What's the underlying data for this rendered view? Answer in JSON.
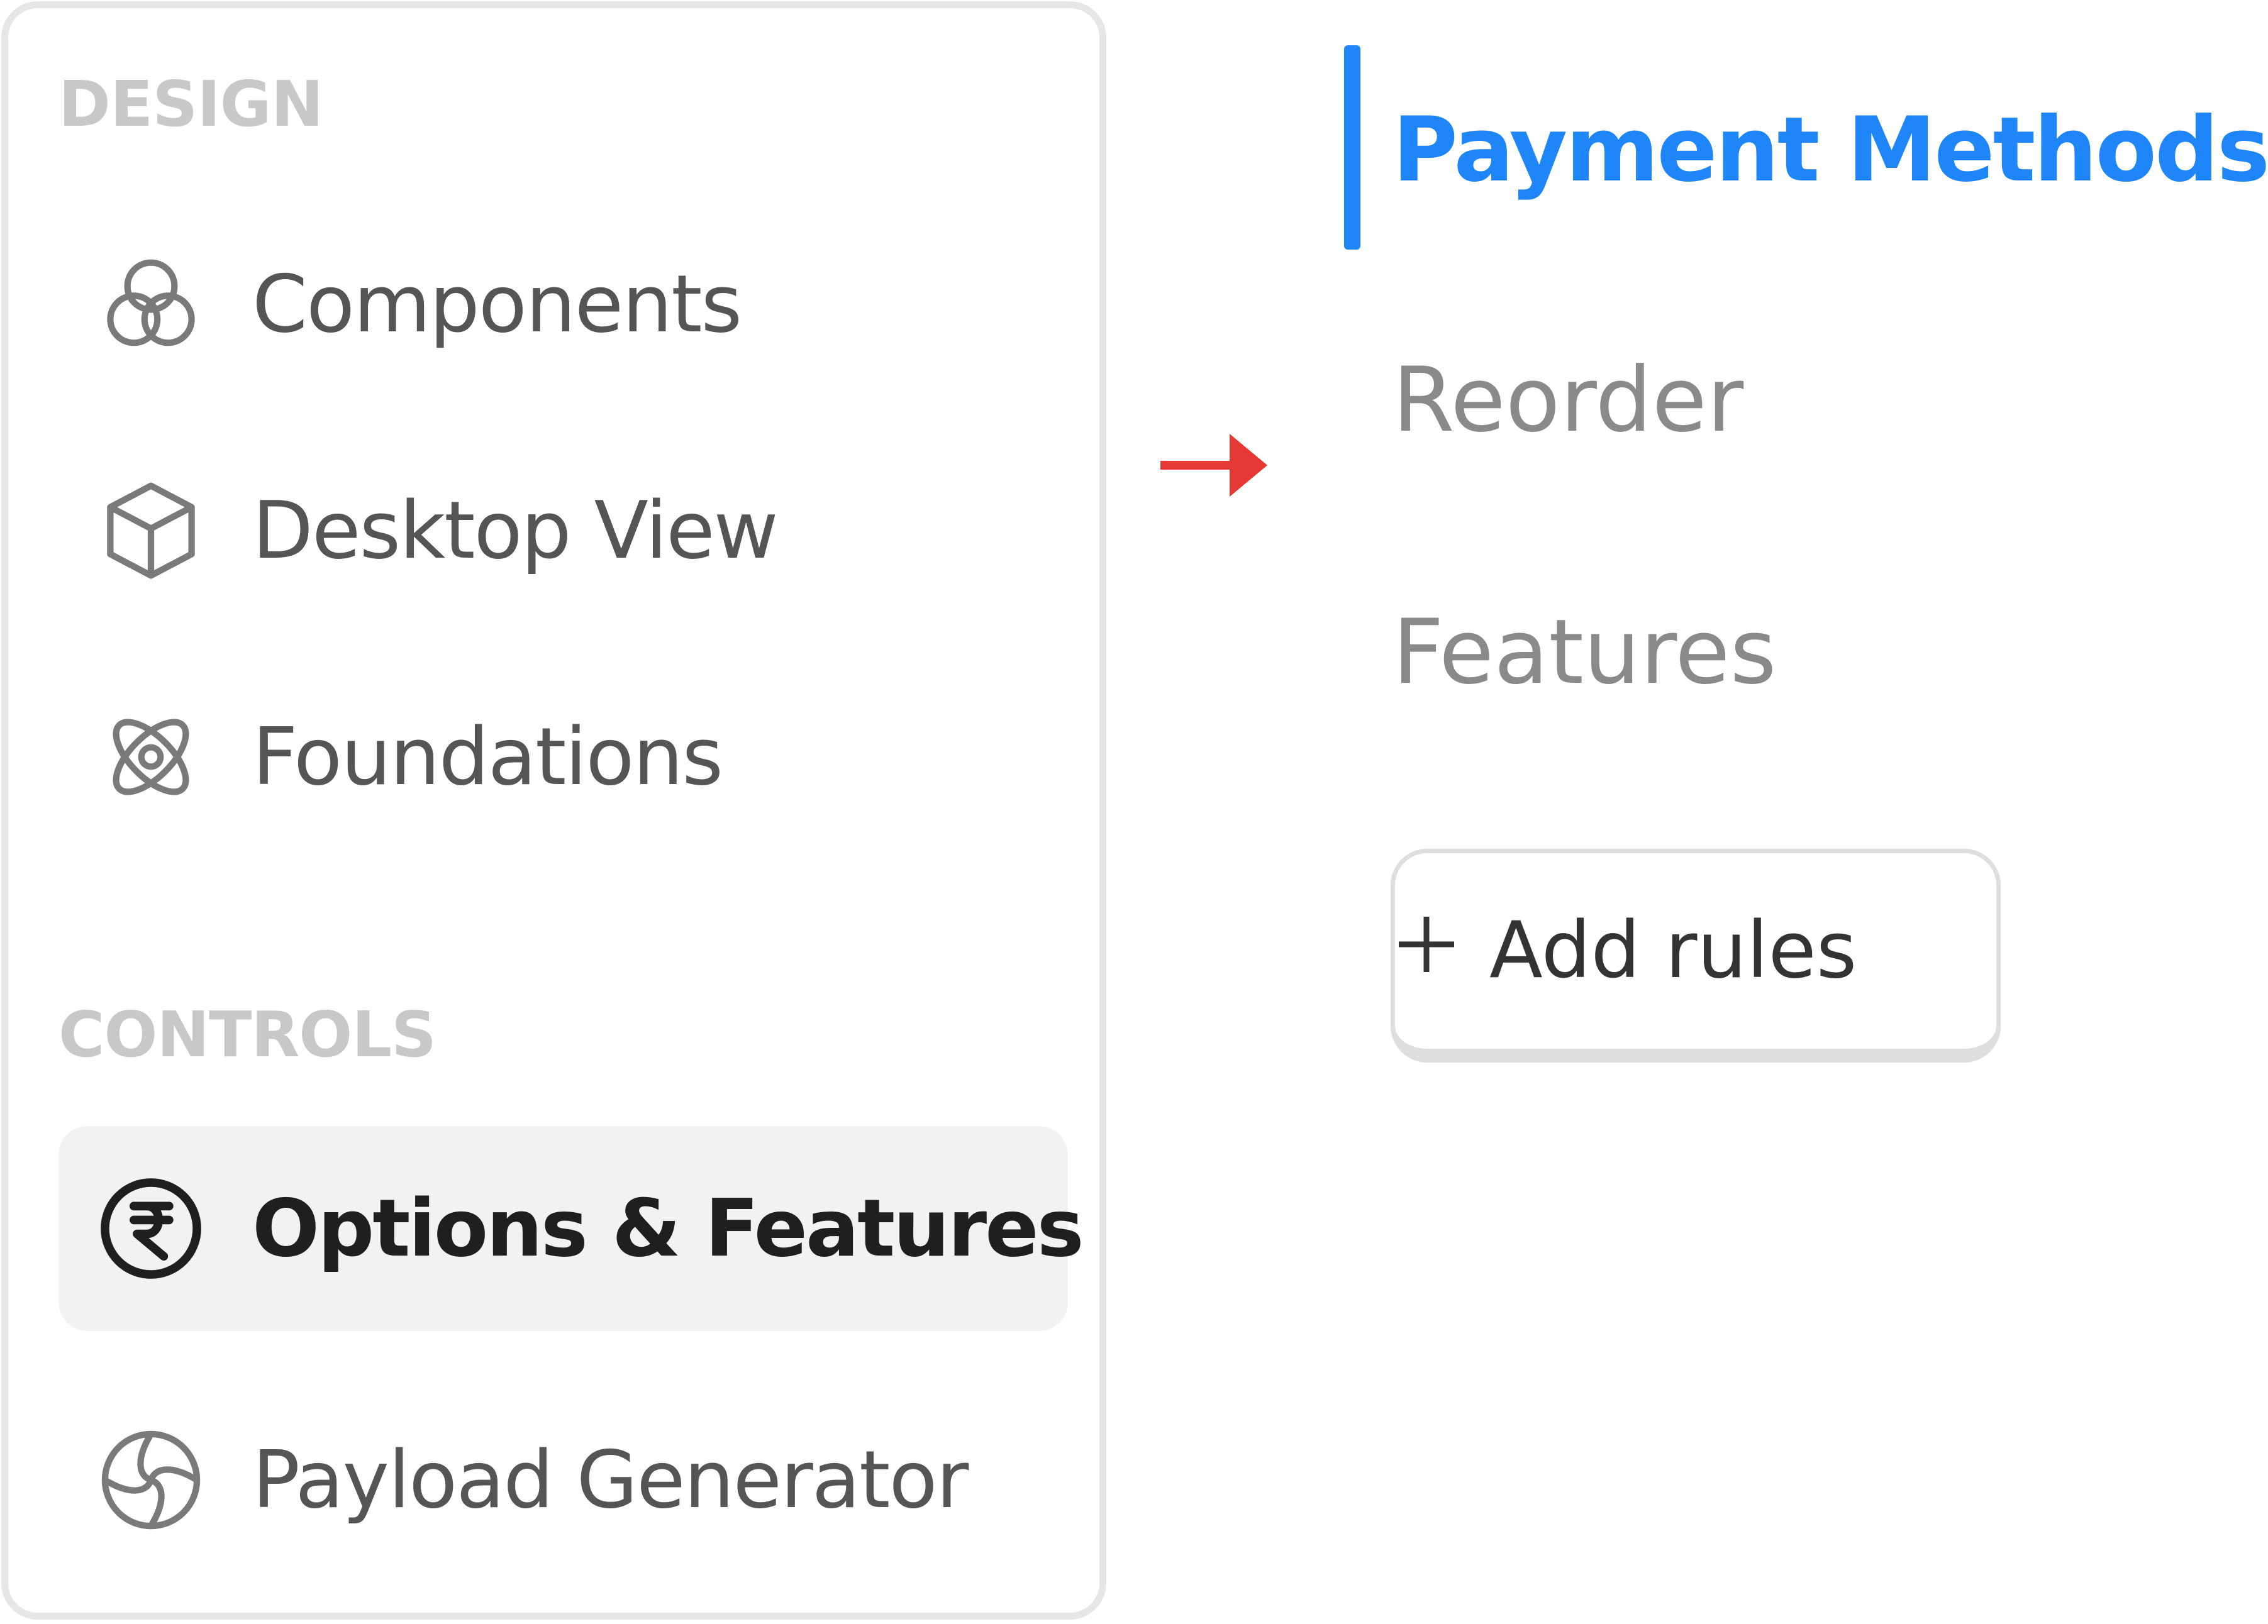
{
  "sidebar": {
    "design_section": {
      "label": "DESIGN",
      "items": [
        {
          "label": "Components",
          "icon": "circles-icon"
        },
        {
          "label": "Desktop View",
          "icon": "cube-icon"
        },
        {
          "label": "Foundations",
          "icon": "atom-icon"
        }
      ]
    },
    "controls_section": {
      "label": "CONTROLS",
      "items": [
        {
          "label": "Options & Features",
          "icon": "rupee-icon",
          "active": true
        },
        {
          "label": "Payload Generator",
          "icon": "aperture-icon"
        }
      ]
    }
  },
  "pointer": {
    "icon": "right-arrow-icon",
    "color": "#e53935"
  },
  "tabs": {
    "items": [
      {
        "label": "Payment Methods",
        "active": true
      },
      {
        "label": "Reorder"
      },
      {
        "label": "Features"
      }
    ],
    "add_rules": {
      "label": "Add rules",
      "icon": "plus-icon"
    }
  },
  "colors": {
    "accent": "#1e86f8",
    "active_bg": "#f2f2f2",
    "muted_text": "#8a8a8a",
    "section_label": "#c8c8c8"
  }
}
